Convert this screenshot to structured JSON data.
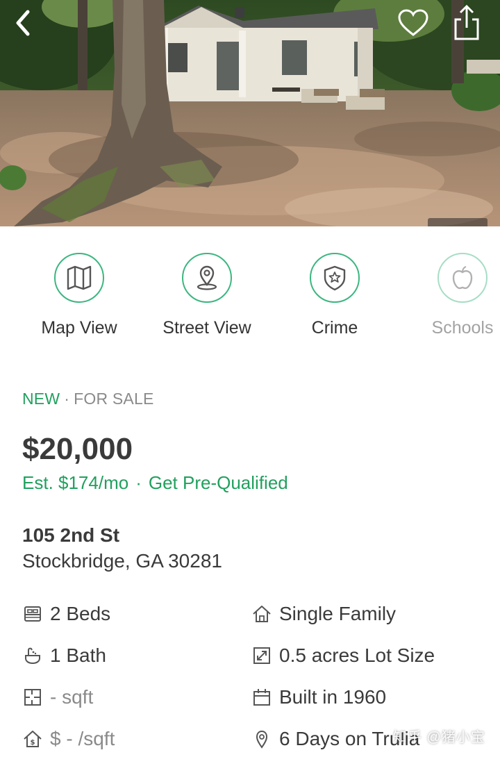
{
  "photo": {
    "back_icon": "chevron-left-icon",
    "favorite_icon": "heart-outline-icon",
    "share_icon": "share-icon"
  },
  "quick_actions": [
    {
      "label": "Map View",
      "icon": "map-icon"
    },
    {
      "label": "Street View",
      "icon": "location-pin-icon"
    },
    {
      "label": "Crime",
      "icon": "shield-star-icon"
    },
    {
      "label": "Schools",
      "icon": "apple-icon"
    }
  ],
  "listing": {
    "badge_new": "NEW",
    "separator": "·",
    "status": "FOR SALE",
    "price": "$20,000",
    "est_payment": "Est. $174/mo",
    "pre_qualify": "Get Pre-Qualified",
    "street": "105 2nd St",
    "city_state_zip": "Stockbridge, GA 30281"
  },
  "facts": {
    "beds": "2 Beds",
    "baths": "1 Bath",
    "sqft": "- sqft",
    "price_per_sqft": "$ - /sqft",
    "type": "Single Family",
    "lot": "0.5 acres Lot Size",
    "built": "Built in 1960",
    "days": "6 Days on Trulia"
  },
  "watermark": "知乎 @猪小宝",
  "colors": {
    "accent_green": "#21a05e",
    "icon_ring": "#3bb67f",
    "text_dark": "#3a3a3a",
    "text_muted": "#8a8a8a"
  }
}
